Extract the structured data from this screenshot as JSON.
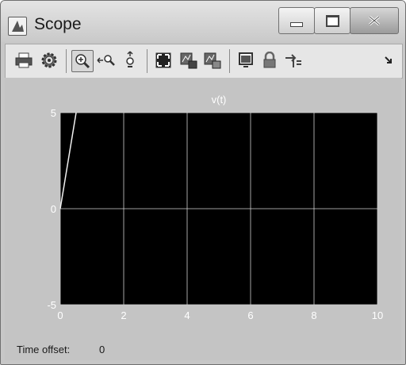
{
  "window": {
    "title": "Scope",
    "icon": "scope-app-icon",
    "controls": [
      "minimize-icon",
      "maximize-icon",
      "close-icon"
    ]
  },
  "toolbar": {
    "buttons": [
      {
        "name": "print-button",
        "icon": "printer-icon"
      },
      {
        "name": "parameters-button",
        "icon": "gear-icon"
      },
      {
        "name": "zoom-in-button",
        "icon": "zoom-in-icon",
        "pressed": true
      },
      {
        "name": "zoom-x-button",
        "icon": "zoom-x-icon"
      },
      {
        "name": "zoom-y-button",
        "icon": "zoom-y-icon"
      },
      {
        "name": "autoscale-button",
        "icon": "autoscale-icon"
      },
      {
        "name": "save-axes-button",
        "icon": "save-axes-icon"
      },
      {
        "name": "restore-axes-button",
        "icon": "restore-axes-icon"
      },
      {
        "name": "floating-scope-button",
        "icon": "floating-scope-icon"
      },
      {
        "name": "lock-axes-button",
        "icon": "lock-icon"
      },
      {
        "name": "signal-selection-button",
        "icon": "signal-selector-icon"
      },
      {
        "name": "dock-button",
        "icon": "dock-arrow-icon"
      }
    ]
  },
  "chart_data": {
    "type": "line",
    "title": "v(t)",
    "xlabel": "",
    "ylabel": "",
    "xlim": [
      0,
      10
    ],
    "ylim": [
      -5,
      5
    ],
    "xticks": [
      "0",
      "2",
      "4",
      "6",
      "8",
      "10"
    ],
    "yticks": [
      "5",
      "0",
      "-5"
    ],
    "grid": true,
    "background": "#000000",
    "grid_color": "#d0d0d0",
    "line_color": "#f0f0f0",
    "series": [
      {
        "x": [
          0,
          0.5
        ],
        "y": [
          0,
          5
        ]
      }
    ]
  },
  "footer": {
    "time_offset_label": "Time offset:",
    "time_offset_value": "0"
  }
}
